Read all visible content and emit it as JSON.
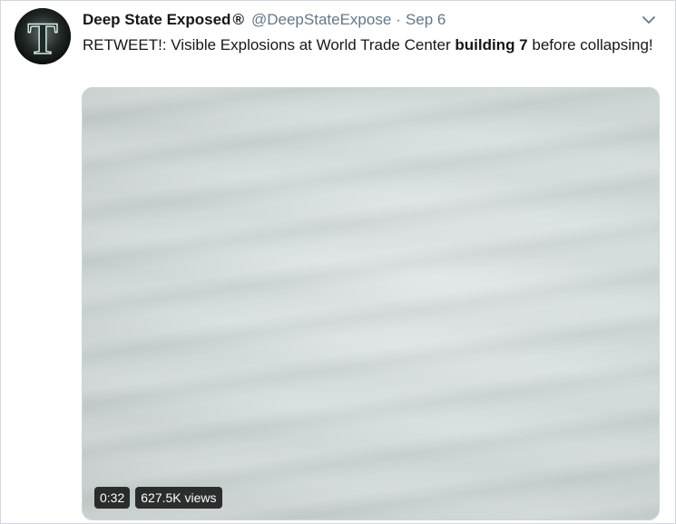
{
  "tweet": {
    "author": {
      "display_name": "Deep State Exposed",
      "registered_mark": "®",
      "handle": "@DeepStateExpose",
      "avatar_letter": "T"
    },
    "separator": "·",
    "date": "Sep 6",
    "menu_icon": "chevron-down-icon",
    "text": {
      "before": "RETWEET!: Visible Explosions at World Trade Center ",
      "bold": "building 7",
      "after": " before collapsing!"
    },
    "media": {
      "type": "video",
      "duration": "0:32",
      "views": "627.5K views"
    }
  },
  "colors": {
    "text_primary": "#14171a",
    "text_secondary": "#657786",
    "border": "#ccd6dd",
    "overlay_bg": "#000000"
  }
}
